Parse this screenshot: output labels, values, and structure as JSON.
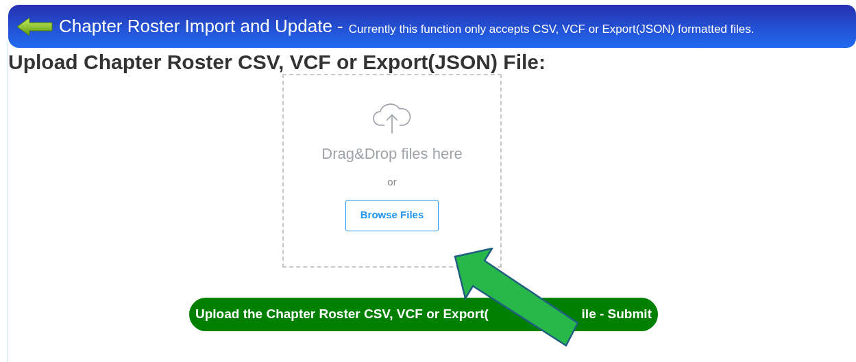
{
  "header": {
    "title": "Chapter Roster Import and Update -",
    "subtitle": "Currently this function only accepts CSV, VCF or Export(JSON) formatted files."
  },
  "heading": "Upload Chapter Roster CSV, VCF or Export(JSON) File:",
  "dropzone": {
    "prompt": "Drag&Drop files here",
    "or": "or",
    "browse": "Browse Files"
  },
  "submit": {
    "visible_start": "Upload the Chapter Roster CSV, VCF or Export(",
    "visible_end": "ile - Submit"
  }
}
